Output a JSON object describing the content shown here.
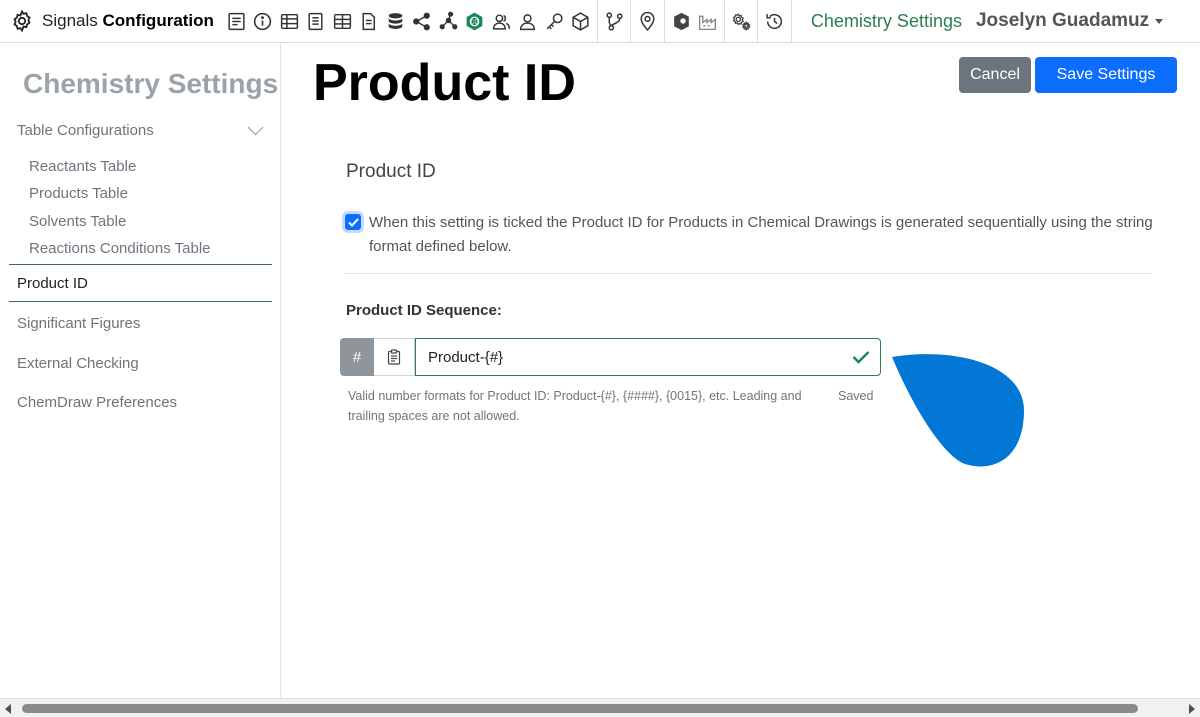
{
  "topbar": {
    "brand_prefix": "Signals",
    "brand_bold": "Configuration",
    "icons": [
      "form-icon",
      "info-icon",
      "table-icon",
      "document-table-icon",
      "grid-table-icon",
      "file-icon",
      "database-icon",
      "share-icon",
      "molecule-icon",
      "chemdraw-icon",
      "group-icon",
      "user-icon",
      "key-icon",
      "cube-icon",
      "branch-icon",
      "location-pin-icon",
      "shield-icon",
      "factory-icon",
      "settings-gears-icon",
      "history-icon"
    ],
    "section_title": "Chemistry Settings",
    "user_name": "Joselyn Guadamuz"
  },
  "sidebar": {
    "title": "Chemistry Settings",
    "section_label": "Table Configurations",
    "sub_items": [
      "Reactants Table",
      "Products Table",
      "Solvents Table",
      "Reactions Conditions Table"
    ],
    "active_item": "Product ID",
    "items": [
      "Significant Figures",
      "External Checking",
      "ChemDraw Preferences"
    ]
  },
  "main": {
    "page_title": "Product ID",
    "cancel_label": "Cancel",
    "save_label": "Save Settings",
    "section_title": "Product ID",
    "checkbox_checked": true,
    "checkbox_text": "When this setting is ticked the Product ID for Products in Chemical Drawings is generated sequentially using the string format defined below.",
    "sequence_label": "Product ID Sequence:",
    "hash_addon": "#",
    "sequence_value": "Product-{#}",
    "help_text": "Valid number formats for Product ID: Product-{#}, {####}, {0015}, etc. Leading and trailing spaces are not allowed.",
    "saved_text": "Saved"
  },
  "colors": {
    "primary": "#0d6efd",
    "secondary": "#6c757d",
    "accent_green": "#2e7d4f",
    "blob": "#0277d6"
  }
}
